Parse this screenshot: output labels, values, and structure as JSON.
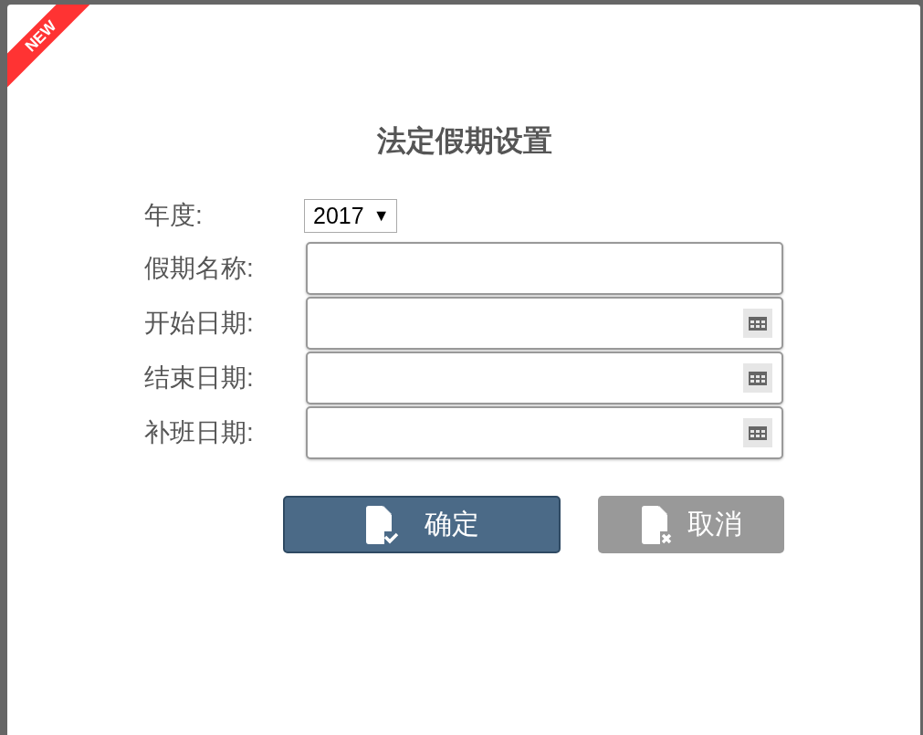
{
  "badge": "NEW",
  "title": "法定假期设置",
  "year": {
    "label": "年度:",
    "value": "2017",
    "arrow": "▼"
  },
  "fields": [
    {
      "label": "假期名称:",
      "kind": "text"
    },
    {
      "label": "开始日期:",
      "kind": "date"
    },
    {
      "label": "结束日期:",
      "kind": "date"
    },
    {
      "label": "补班日期:",
      "kind": "date"
    }
  ],
  "buttons": [
    {
      "label": "确定",
      "kind": "confirm"
    },
    {
      "label": "取消",
      "kind": "cancel"
    }
  ]
}
